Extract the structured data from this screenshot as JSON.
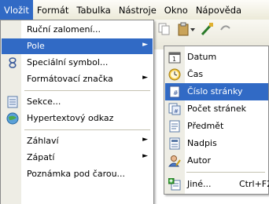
{
  "menubar": {
    "items": [
      {
        "label": "Vložit",
        "active": true
      },
      {
        "label": "Formát",
        "active": false
      },
      {
        "label": "Tabulka",
        "active": false
      },
      {
        "label": "Nástroje",
        "active": false
      },
      {
        "label": "Okno",
        "active": false
      },
      {
        "label": "Nápověda",
        "active": false
      }
    ]
  },
  "insert_menu": {
    "items": [
      {
        "label": "Ruční zalomení...",
        "icon": "none",
        "submenu": false,
        "highlighted": false
      },
      {
        "label": "Pole",
        "icon": "none",
        "submenu": true,
        "highlighted": true
      },
      {
        "label": "Speciální symbol...",
        "icon": "special-symbol-icon",
        "submenu": false,
        "highlighted": false
      },
      {
        "label": "Formátovací značka",
        "icon": "none",
        "submenu": true,
        "highlighted": false
      },
      {
        "label": "Sekce...",
        "icon": "section-icon",
        "submenu": false,
        "highlighted": false
      },
      {
        "label": "Hypertextový odkaz",
        "icon": "hyperlink-icon",
        "submenu": false,
        "highlighted": false
      },
      {
        "label": "Záhlaví",
        "icon": "none",
        "submenu": true,
        "highlighted": false
      },
      {
        "label": "Zápatí",
        "icon": "none",
        "submenu": true,
        "highlighted": false
      },
      {
        "label": "Poznámka pod čarou...",
        "icon": "none",
        "submenu": false,
        "highlighted": false
      }
    ]
  },
  "fields_submenu": {
    "items": [
      {
        "label": "Datum",
        "icon": "date-icon",
        "highlighted": false,
        "shortcut": ""
      },
      {
        "label": "Čas",
        "icon": "time-icon",
        "highlighted": false,
        "shortcut": ""
      },
      {
        "label": "Číslo stránky",
        "icon": "page-number-icon",
        "highlighted": true,
        "shortcut": ""
      },
      {
        "label": "Počet stránek",
        "icon": "page-count-icon",
        "highlighted": false,
        "shortcut": ""
      },
      {
        "label": "Předmět",
        "icon": "subject-icon",
        "highlighted": false,
        "shortcut": ""
      },
      {
        "label": "Nadpis",
        "icon": "title-icon",
        "highlighted": false,
        "shortcut": ""
      },
      {
        "label": "Autor",
        "icon": "author-icon",
        "highlighted": false,
        "shortcut": ""
      },
      {
        "label": "Jiné...",
        "icon": "other-fields-icon",
        "highlighted": false,
        "shortcut": "Ctrl+F2"
      }
    ]
  },
  "colors": {
    "highlight": "#316ac5",
    "menu_bg": "#ffffff",
    "gutter": "#eeede5",
    "menubar_bg": "#ecead8"
  }
}
